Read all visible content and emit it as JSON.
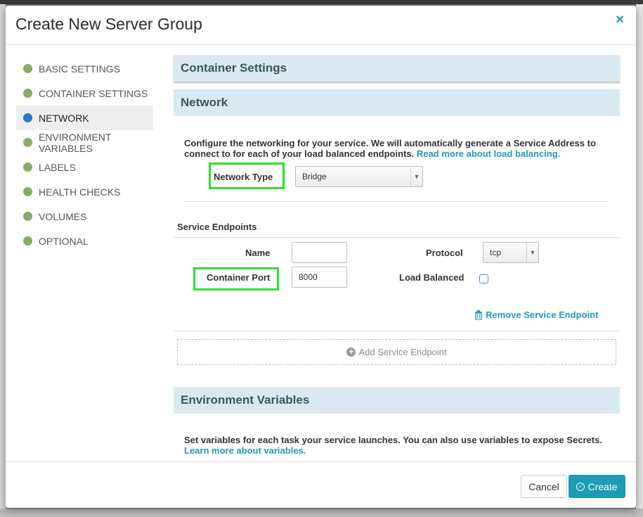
{
  "modal": {
    "title": "Create New Server Group",
    "close_icon": "×"
  },
  "sidebar": {
    "items": [
      {
        "label": "BASIC SETTINGS",
        "status_color": "#8aab62"
      },
      {
        "label": "CONTAINER SETTINGS",
        "status_color": "#8aab62"
      },
      {
        "label": "NETWORK",
        "status_color": "#2a77c4",
        "active": true
      },
      {
        "label": "ENVIRONMENT VARIABLES",
        "status_color": "#8aab62"
      },
      {
        "label": "LABELS",
        "status_color": "#8aab62"
      },
      {
        "label": "HEALTH CHECKS",
        "status_color": "#8aab62"
      },
      {
        "label": "VOLUMES",
        "status_color": "#8aab62"
      },
      {
        "label": "OPTIONAL",
        "status_color": "#8aab62"
      }
    ]
  },
  "main": {
    "container_settings_header": "Container Settings",
    "network_header": "Network",
    "network_desc": "Configure the networking for your service. We will automatically generate a Service Address to connect to for each of your load balanced endpoints.",
    "network_link": "Read more about load balancing.",
    "network_type_label": "Network Type",
    "network_type_value": "Bridge",
    "service_endpoints_label": "Service Endpoints",
    "name_label": "Name",
    "name_value": "",
    "protocol_label": "Protocol",
    "protocol_value": "tcp",
    "container_port_label": "Container Port",
    "container_port_value": "8000",
    "load_balanced_label": "Load Balanced",
    "remove_endpoint_label": "Remove Service Endpoint",
    "add_endpoint_label": "Add Service Endpoint",
    "env_header": "Environment Variables",
    "env_desc": "Set variables for each task your service launches. You can also use variables to expose Secrets.",
    "env_link": "Learn more about variables."
  },
  "footer": {
    "cancel_label": "Cancel",
    "create_label": "Create"
  },
  "colors": {
    "accent": "#1e9bb5",
    "highlight": "#2fe02f",
    "section_bg": "#d9e9ef"
  }
}
